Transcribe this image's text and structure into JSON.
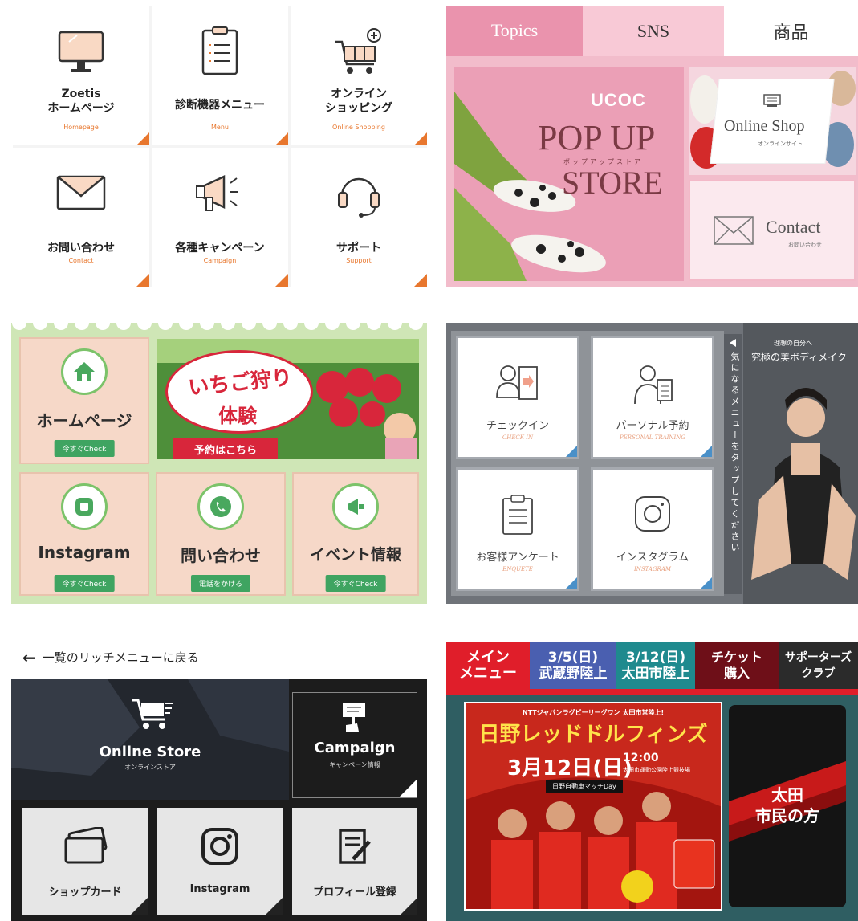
{
  "panel1": {
    "items": [
      {
        "title": "Zoetis\nホームページ",
        "sub": "Homepage"
      },
      {
        "title": "診断機器メニュー",
        "sub": "Menu"
      },
      {
        "title": "オンライン\nショッピング",
        "sub": "Online Shopping"
      },
      {
        "title": "お問い合わせ",
        "sub": "Contact"
      },
      {
        "title": "各種キャンペーン",
        "sub": "Campaign"
      },
      {
        "title": "サポート",
        "sub": "Support"
      }
    ],
    "accent": "#e8772e"
  },
  "panel2": {
    "tabs": [
      "Topics",
      "SNS",
      "商品"
    ],
    "logo": "UCOC",
    "popup_line1": "POP UP",
    "popup_kana": "ポップアップストア",
    "popup_line2": "STORE",
    "shop_label": "Online Shop",
    "shop_sub": "オンラインサイト",
    "contact_label": "Contact",
    "contact_sub": "お問い合わせ"
  },
  "panel3": {
    "home": {
      "label": "ホームページ",
      "check": "今すぐCheck"
    },
    "banner": {
      "title": "いちご狩り",
      "title2": "体験",
      "cta": "予約はこちら"
    },
    "instagram": {
      "label": "Instagram",
      "check": "今すぐCheck"
    },
    "contact": {
      "label": "問い合わせ",
      "check": "電話をかける"
    },
    "event": {
      "label": "イベント情報",
      "check": "今すぐCheck"
    }
  },
  "panel4": {
    "cards": [
      {
        "jp": "チェックイン",
        "en": "CHECK IN"
      },
      {
        "jp": "パーソナル予約",
        "en": "PERSONAL TRAINING"
      },
      {
        "jp": "お客様アンケート",
        "en": "ENQUETE"
      },
      {
        "jp": "インスタグラム",
        "en": "INSTAGRAM"
      }
    ],
    "vertical_hint": "気になるメニューをタップしてください",
    "tagline_small": "理想の自分へ",
    "tagline": "究極の美ボディメイク"
  },
  "panel5": {
    "back": "一覧のリッチメニューに戻る",
    "store": {
      "title": "Online Store",
      "sub": "オンラインストア"
    },
    "campaign": {
      "title": "Campaign",
      "sub": "キャンペーン情報"
    },
    "tiles": [
      "ショップカード",
      "Instagram",
      "プロフィール登録"
    ]
  },
  "panel6": {
    "tabs": [
      {
        "l1": "メイン",
        "l2": "メニュー"
      },
      {
        "l1": "3/5(日)",
        "l2": "武蔵野陸上"
      },
      {
        "l1": "3/12(日)",
        "l2": "太田市陸上"
      },
      {
        "l1": "チケット",
        "l2": "購入"
      },
      {
        "l1": "サポーターズ",
        "l2": "クラブ"
      }
    ],
    "poster_top": "NTTジャパンラグビーリーグワン 太田市営陸上!",
    "poster_title": "日野レッドドルフィンズ",
    "poster_date": "3月12日(日)",
    "poster_time": "12:00",
    "poster_venue": "太田市運動公園陸上競技場",
    "poster_badge": "日野自動車マッチDay",
    "side_line1": "太田",
    "side_line2": "市民の方"
  }
}
